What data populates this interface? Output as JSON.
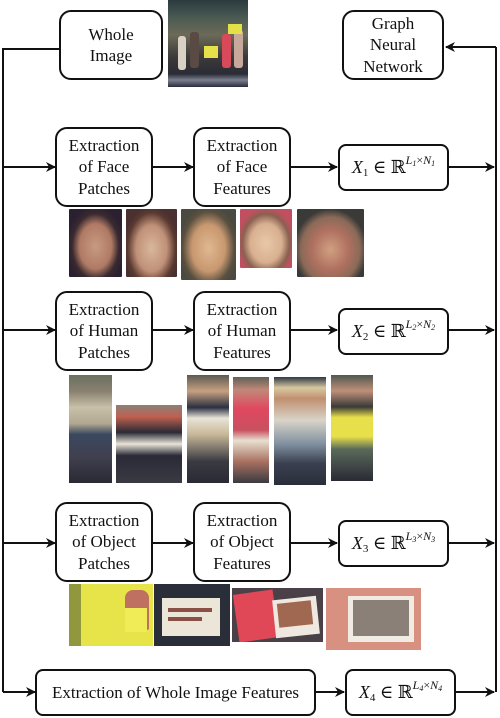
{
  "diagram": {
    "input": {
      "label_line1": "Whole",
      "label_line2": "Image",
      "thumbnail": "protest-crowd-photo"
    },
    "output": {
      "label_line1": "Graph",
      "label_line2": "Neural",
      "label_line3": "Network"
    },
    "branches": [
      {
        "id": "face",
        "patch_step": [
          "Extraction",
          "of Face",
          "Patches"
        ],
        "feature_step": [
          "Extraction",
          "of Face",
          "Features"
        ],
        "output_var": "X",
        "output_index": "1",
        "L": "L",
        "L_index": "1",
        "N": "N",
        "N_index": "1",
        "patches": [
          "face-woman",
          "face-bearded-young-man",
          "face-smiling-man",
          "face-girl",
          "face-older-bearded-man"
        ]
      },
      {
        "id": "human",
        "patch_step": [
          "Extraction",
          "of Human",
          "Patches"
        ],
        "feature_step": [
          "Extraction",
          "of Human",
          "Features"
        ],
        "output_var": "X",
        "output_index": "2",
        "L": "L",
        "L_index": "2",
        "N": "N",
        "N_index": "2",
        "patches": [
          "person-woman-standing",
          "person-crouching-with-sign",
          "person-man-with-sign",
          "person-woman-pink-shirt",
          "person-man-with-hat",
          "person-woman-yellow-sign"
        ]
      },
      {
        "id": "object",
        "patch_step": [
          "Extraction",
          "of Object",
          "Patches"
        ],
        "feature_step": [
          "Extraction",
          "of Object",
          "Features"
        ],
        "output_var": "X",
        "output_index": "3",
        "L": "L",
        "L_index": "3",
        "N": "N",
        "N_index": "3",
        "patches": [
          "sign-yellow-its-not-food-its-violence",
          "sign-white-its-not-food",
          "sign-red-with-photo",
          "sign-photo-print"
        ]
      }
    ],
    "whole_image_branch": {
      "step": "Extraction of Whole Image Features",
      "output_var": "X",
      "output_index": "4",
      "L": "L",
      "L_index": "4",
      "N": "N",
      "N_index": "4"
    },
    "symbols": {
      "element_of": "∈",
      "reals": "ℝ",
      "times": "×"
    }
  }
}
